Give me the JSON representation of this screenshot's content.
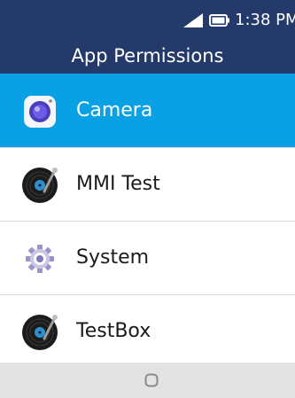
{
  "status_bar": {
    "time": "1:38 PM",
    "signal_icon": "signal-icon",
    "battery_icon": "battery-icon"
  },
  "header": {
    "title": "App Permissions"
  },
  "apps": [
    {
      "label": "Camera",
      "icon": "camera-icon",
      "selected": true
    },
    {
      "label": "MMI Test",
      "icon": "vinyl-record-icon",
      "selected": false
    },
    {
      "label": "System",
      "icon": "gear-icon",
      "selected": false
    },
    {
      "label": "TestBox",
      "icon": "vinyl-record-icon",
      "selected": false
    }
  ],
  "nav": {
    "home_icon": "home-icon"
  },
  "colors": {
    "header_bg": "#243a6b",
    "selected_bg": "#0aa1e4",
    "nav_bg": "#e3e3e3"
  }
}
